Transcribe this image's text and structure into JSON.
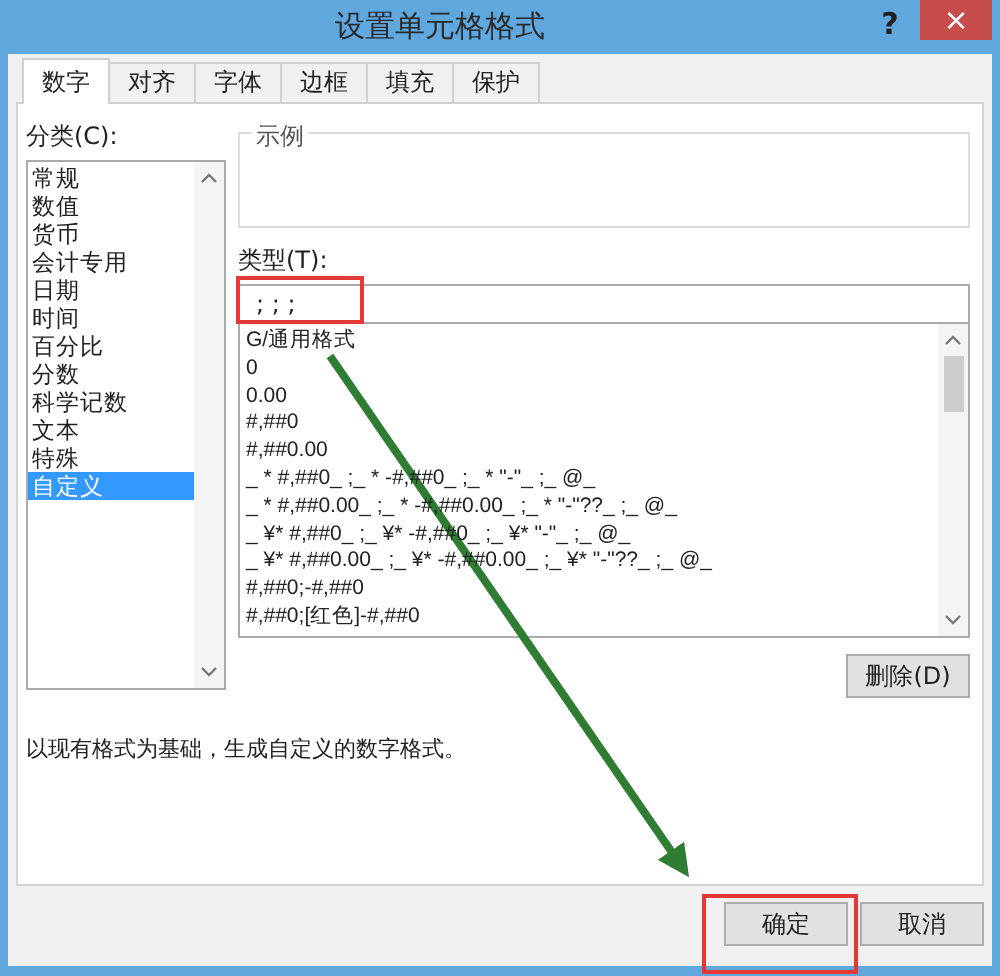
{
  "window": {
    "title": "设置单元格格式",
    "help": "?",
    "close": "×"
  },
  "tabs": [
    {
      "label": "数字",
      "selected": true
    },
    {
      "label": "对齐",
      "selected": false
    },
    {
      "label": "字体",
      "selected": false
    },
    {
      "label": "边框",
      "selected": false
    },
    {
      "label": "填充",
      "selected": false
    },
    {
      "label": "保护",
      "selected": false
    }
  ],
  "category": {
    "label": "分类(C):",
    "items": [
      {
        "label": "常规",
        "selected": false
      },
      {
        "label": "数值",
        "selected": false
      },
      {
        "label": "货币",
        "selected": false
      },
      {
        "label": "会计专用",
        "selected": false
      },
      {
        "label": "日期",
        "selected": false
      },
      {
        "label": "时间",
        "selected": false
      },
      {
        "label": "百分比",
        "selected": false
      },
      {
        "label": "分数",
        "selected": false
      },
      {
        "label": "科学记数",
        "selected": false
      },
      {
        "label": "文本",
        "selected": false
      },
      {
        "label": "特殊",
        "selected": false
      },
      {
        "label": "自定义",
        "selected": true
      }
    ]
  },
  "sample": {
    "label": "示例"
  },
  "type": {
    "label": "类型(T):",
    "value": "; ; ;",
    "formats": [
      "G/通用格式",
      "0",
      "0.00",
      "#,##0",
      "#,##0.00",
      "_ * #,##0_ ;_ * -#,##0_ ;_ * \"-\"_ ;_ @_",
      "_ * #,##0.00_ ;_ * -#,##0.00_ ;_ * \"-\"??_ ;_ @_",
      "_ ¥* #,##0_ ;_ ¥* -#,##0_ ;_ ¥* \"-\"_ ;_ @_",
      "_ ¥* #,##0.00_ ;_ ¥* -#,##0.00_ ;_ ¥* \"-\"??_ ;_ @_",
      "#,##0;-#,##0",
      "#,##0;[红色]-#,##0"
    ]
  },
  "delete_button": "删除(D)",
  "description": "以现有格式为基础，生成自定义的数字格式。",
  "buttons": [
    "确定",
    "取消"
  ]
}
